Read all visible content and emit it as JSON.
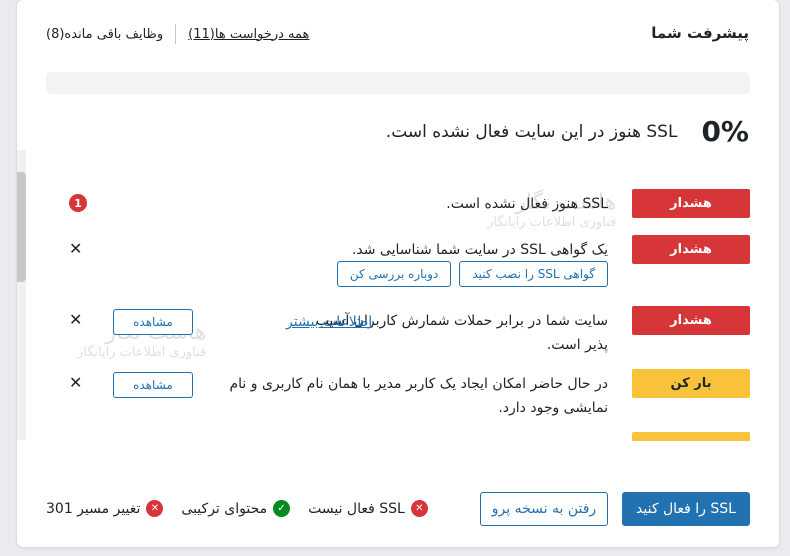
{
  "header": {
    "title": "پیشرفت شما",
    "all_notices": "همه درخواست ها(11)",
    "remaining_tasks": "وظایف باقی مانده(8)"
  },
  "progress": {
    "percent_label": "0%",
    "value": 0,
    "text": "SSL هنوز در این سایت فعال نشده است."
  },
  "tasks": [
    {
      "status": "هشدار",
      "type": "warning",
      "text": "SSL هنوز فعال نشده است.",
      "count": "1"
    },
    {
      "status": "هشدار",
      "type": "warning",
      "text": "یک گواهی SSL در سایت شما شناسایی شد.",
      "action1": "گواهی SSL را نصب کنید",
      "action2": "دوباره بررسی کن"
    },
    {
      "status": "هشدار",
      "type": "warning",
      "text": "سایت شما در برابر حملات شمارش کاربران آسیب پذیر است.",
      "more_link": "اطلاعات بیشتر",
      "view": "مشاهده"
    },
    {
      "status": "بار کن",
      "type": "open",
      "text": "در حال حاضر امکان ایجاد یک کاربر مدیر با همان نام کاربری و نام نمایشی وجود دارد.",
      "view": "مشاهده"
    }
  ],
  "footer": {
    "primary": "SSL را فعال کنید",
    "secondary": "رفتن به نسخه پرو",
    "statuses": [
      {
        "label": "SSL فعال نیست",
        "state": "bad",
        "icon": "x-circle-icon"
      },
      {
        "label": "محتوای ترکیبی",
        "state": "good",
        "icon": "check-circle-icon"
      },
      {
        "label": "تغییر مسیر 301",
        "state": "bad",
        "icon": "x-circle-icon"
      }
    ]
  },
  "watermark": {
    "brand": "هاست نگار",
    "tagline": "فناوری اطلاعات رایانگار"
  },
  "colors": {
    "primary": "#2271b1",
    "warning": "#d63638",
    "open": "#f8c33a",
    "good": "#008a20"
  }
}
